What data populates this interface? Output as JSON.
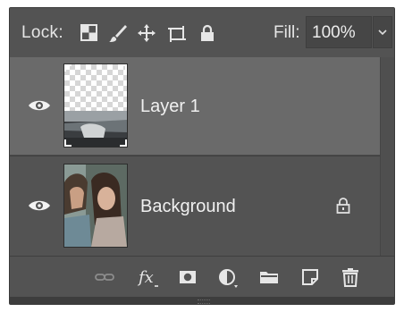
{
  "lock_bar": {
    "lock_label": "Lock:",
    "lock_icons": [
      "lock-transparent-pixels-icon",
      "lock-image-pixels-icon",
      "lock-position-icon",
      "prevent-auto-nesting-icon",
      "lock-all-icon"
    ],
    "fill_label": "Fill:",
    "fill_value": "100%"
  },
  "layers": [
    {
      "name": "Layer 1",
      "visible": true,
      "selected": true,
      "locked": false
    },
    {
      "name": "Background",
      "visible": true,
      "selected": false,
      "locked": true
    }
  ],
  "toolbar_icons": [
    "link-layers-icon",
    "fx-icon",
    "layer-mask-icon",
    "adjustment-layer-icon",
    "new-group-icon",
    "new-layer-icon",
    "delete-layer-icon"
  ],
  "colors": {
    "panel_bg": "#535353",
    "selected_row": "#6a6a6a",
    "text": "#f0f0f0"
  }
}
